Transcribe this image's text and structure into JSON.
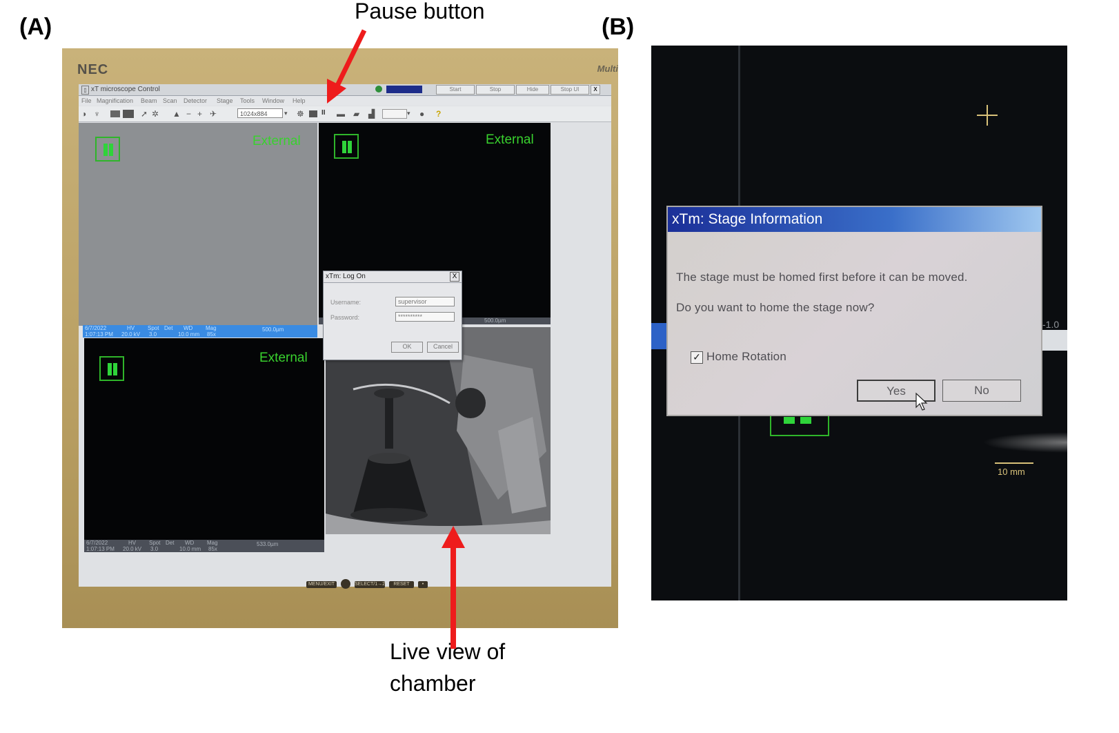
{
  "figure": {
    "panel_a_label": "(A)",
    "panel_b_label": "(B)",
    "callout_pause": "Pause button",
    "callout_live_line1": "Live view of",
    "callout_live_line2": "chamber"
  },
  "monitor": {
    "brand": "NEC",
    "model": "Multi",
    "bezel_buttons": [
      "MENU/EXIT",
      "SELECT/1→2",
      "RESET"
    ]
  },
  "app": {
    "title": "xT microscope Control",
    "title_buttons": [
      "Start",
      "Stop",
      "Hide",
      "Stop UI"
    ],
    "close_glyph": "X",
    "menu": [
      "File",
      "Magnification",
      "Beam",
      "Scan",
      "Detector",
      "Stage",
      "Tools",
      "Window",
      "Help"
    ],
    "resolution": "1024x884",
    "pause_glyph": "II",
    "help_glyph": "?",
    "quads": [
      {
        "label": "External"
      },
      {
        "label": "External"
      },
      {
        "label": "External"
      }
    ],
    "databar_top": {
      "date": "6/7/2022",
      "time": "1:07:13 PM",
      "hv_label": "HV",
      "hv": "20.0 kV",
      "spot_label": "Spot",
      "spot": "3.0",
      "det_label": "Det",
      "wd_label": "WD",
      "wd": "10.0 mm",
      "mag_label": "Mag",
      "mag": "85x",
      "scale": "500.0µm"
    },
    "databar_bottom": {
      "date": "6/7/2022",
      "time": "1:07:13 PM",
      "hv_label": "HV",
      "hv": "20.0 kV",
      "spot_label": "Spot",
      "spot": "3.0",
      "det_label": "Det",
      "wd_label": "WD",
      "wd": "10.0 mm",
      "mag_label": "Mag",
      "mag": "85x",
      "scale": "533.0µm"
    },
    "scale_right": "500.0µm"
  },
  "logon_dialog": {
    "title": "xTm: Log On",
    "close_glyph": "X",
    "username_label": "Username:",
    "username_value": "supervisor",
    "password_label": "Password:",
    "password_value": "**********",
    "ok_label": "OK",
    "cancel_label": "Cancel"
  },
  "stage_dialog": {
    "title": "xTm: Stage Information",
    "message1": "The stage must be homed first before it can be moved.",
    "message2": "Do you want to home the stage now?",
    "checkbox_label": "Home Rotation",
    "checkbox_checked": true,
    "check_glyph": "✓",
    "yes_label": "Yes",
    "no_label": "No"
  },
  "panel_b_view": {
    "scale_label": "10 mm",
    "edge_value": "-1.0",
    "crosshair_color": "#d9c27a"
  }
}
